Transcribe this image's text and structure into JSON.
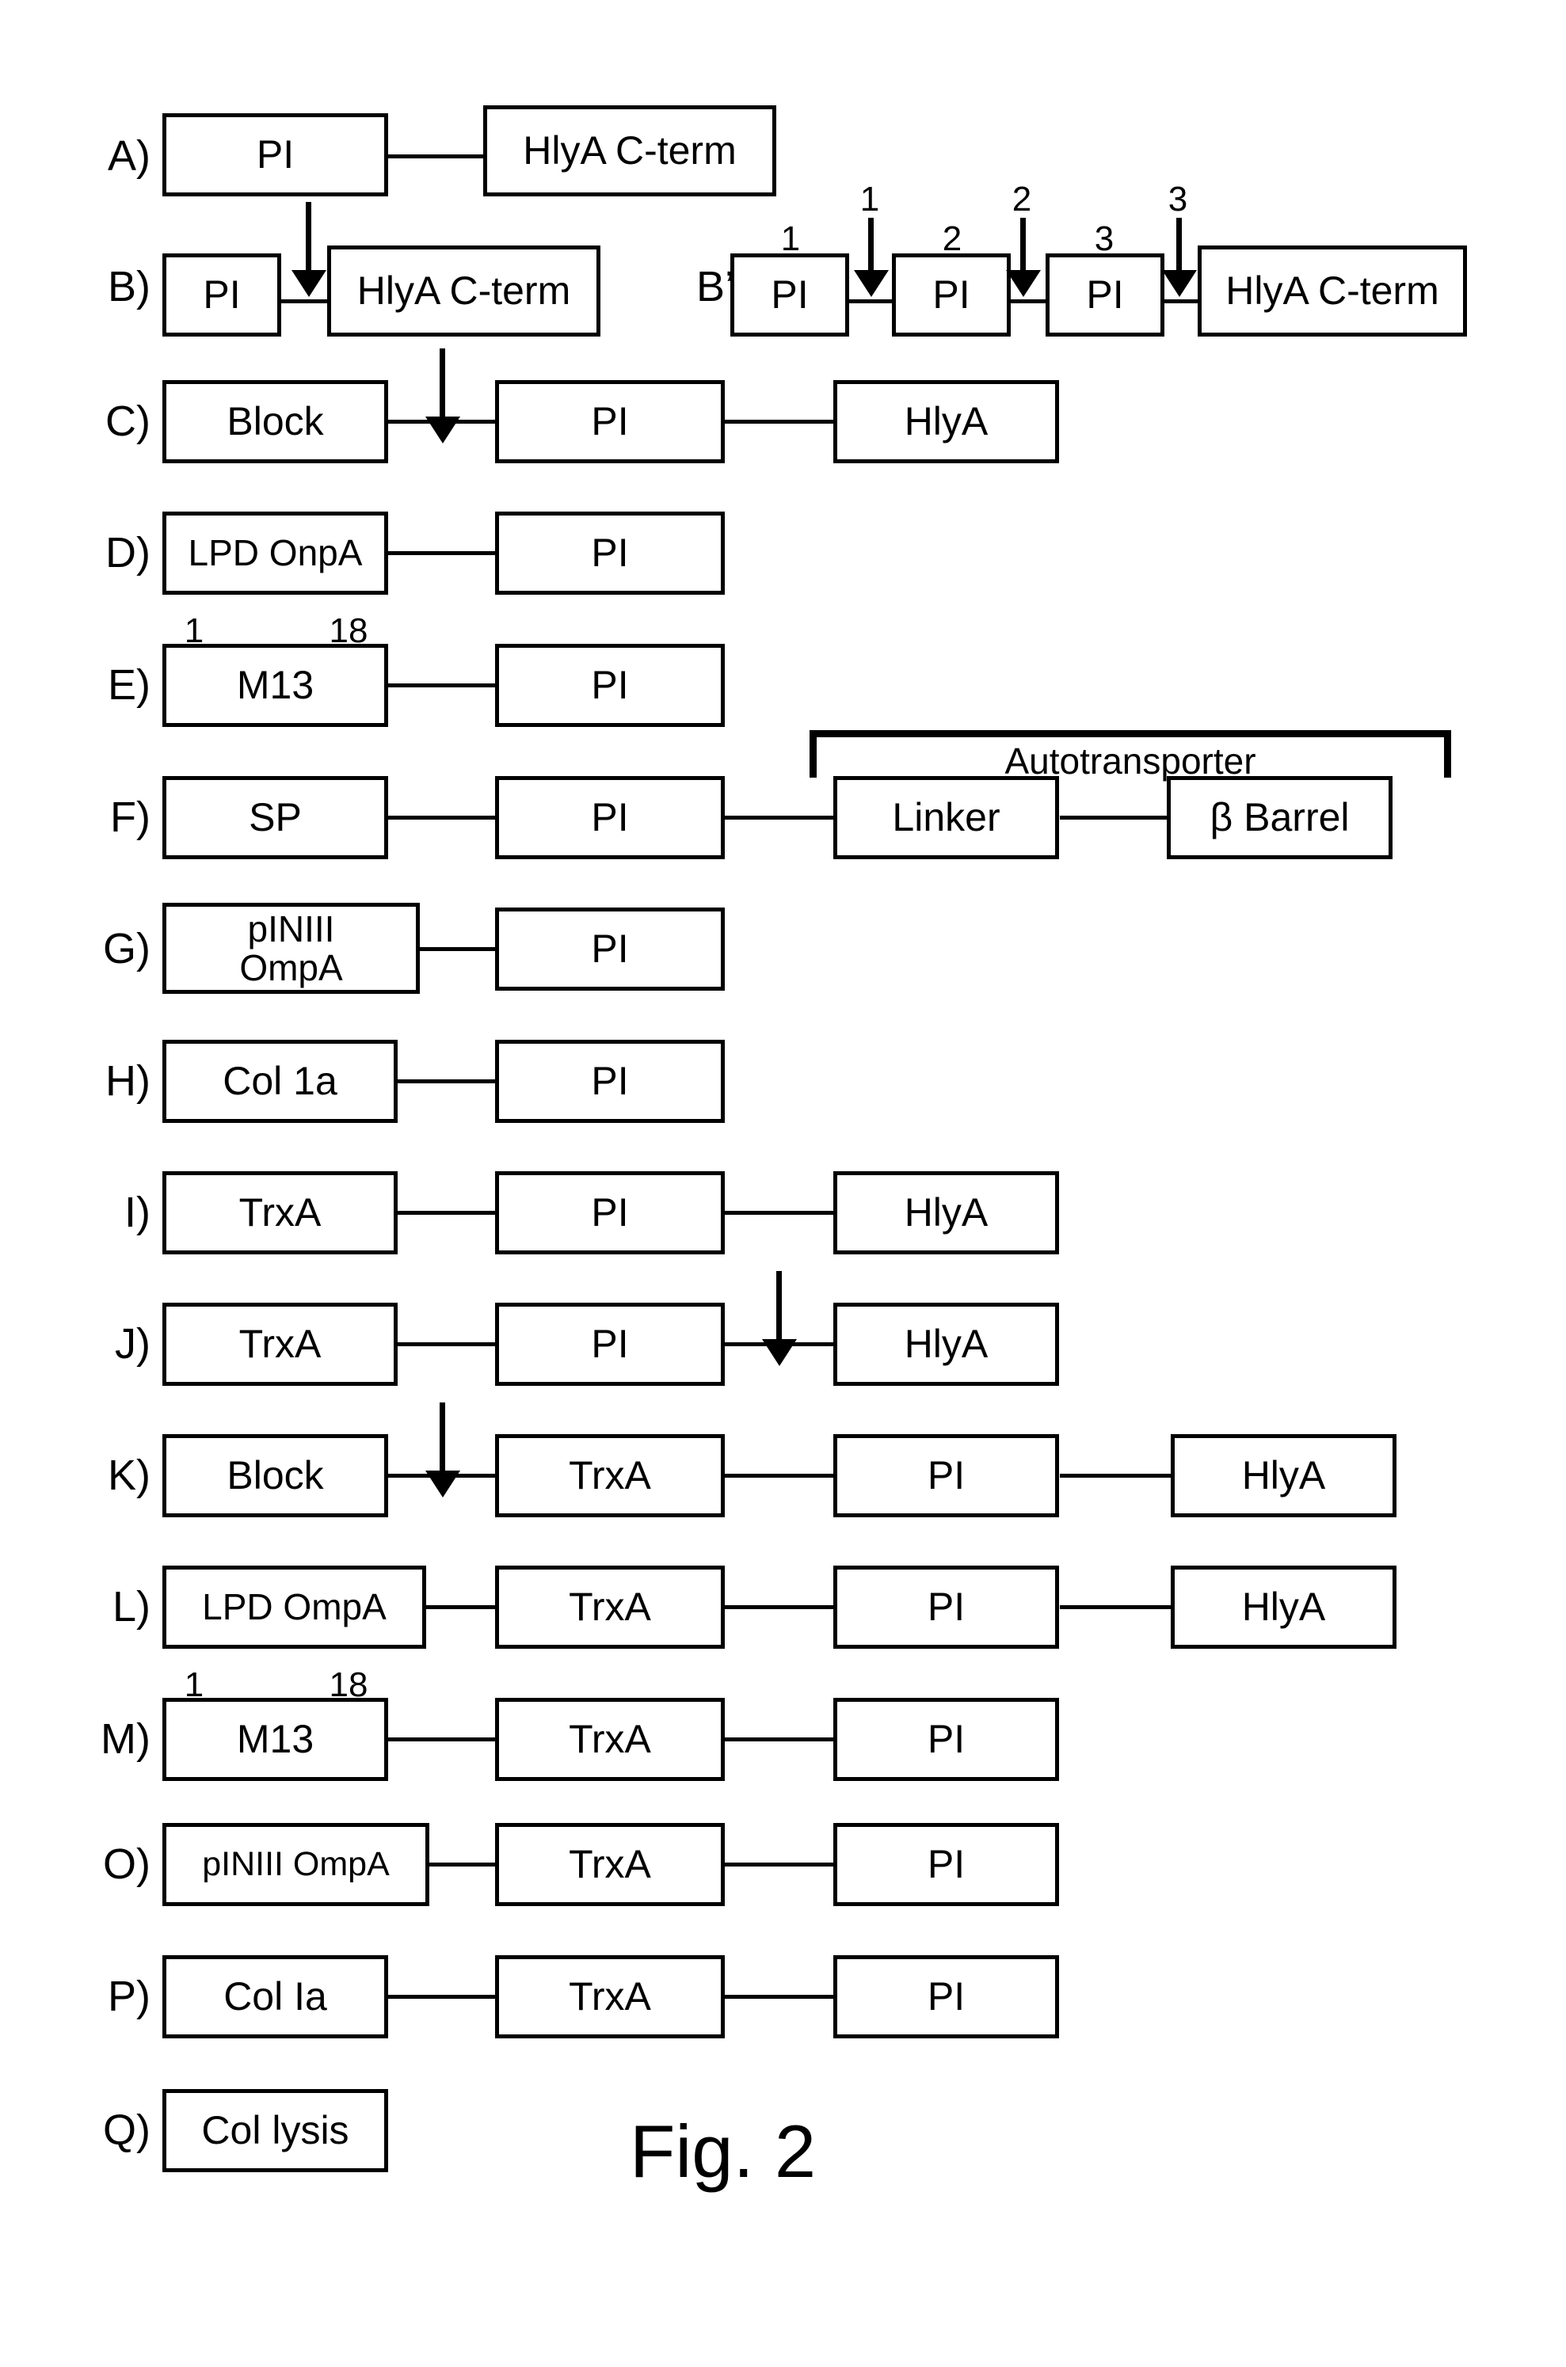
{
  "figure": {
    "caption": "Fig. 2",
    "rows": [
      {
        "id": "A",
        "letter": "A)",
        "boxes": [
          {
            "label": "PI"
          },
          {
            "label": "HlyA C-term"
          }
        ],
        "arrows": [],
        "annotations": []
      },
      {
        "id": "B",
        "letter": "B)",
        "boxes": [
          {
            "label": "PI"
          },
          {
            "label": "HlyA C-term"
          }
        ],
        "arrows": [
          {
            "target": "connector-1"
          }
        ],
        "annotations": []
      },
      {
        "id": "Bprime",
        "letter": "B’)",
        "boxes": [
          {
            "label": "PI",
            "top_number": "1"
          },
          {
            "label": "PI",
            "top_number": "2"
          },
          {
            "label": "PI",
            "top_number": "3"
          },
          {
            "label": "HlyA C-term"
          }
        ],
        "arrows": [
          {
            "target": "connector-1",
            "number": "1"
          },
          {
            "target": "connector-2",
            "number": "2"
          },
          {
            "target": "connector-3",
            "number": "3"
          }
        ],
        "annotations": []
      },
      {
        "id": "C",
        "letter": "C)",
        "boxes": [
          {
            "label": "Block"
          },
          {
            "label": "PI"
          },
          {
            "label": "HlyA"
          }
        ],
        "arrows": [
          {
            "target": "connector-1"
          }
        ],
        "annotations": []
      },
      {
        "id": "D",
        "letter": "D)",
        "boxes": [
          {
            "label": "LPD OnpA"
          },
          {
            "label": "PI"
          }
        ],
        "arrows": [],
        "annotations": []
      },
      {
        "id": "E",
        "letter": "E)",
        "boxes": [
          {
            "label": "M13",
            "top_left_number": "1",
            "top_right_number": "18"
          },
          {
            "label": "PI"
          }
        ],
        "arrows": [],
        "annotations": []
      },
      {
        "id": "F",
        "letter": "F)",
        "boxes": [
          {
            "label": "SP"
          },
          {
            "label": "PI"
          },
          {
            "label": "Linker"
          },
          {
            "label": "β Barrel"
          }
        ],
        "arrows": [],
        "annotations": [
          {
            "type": "bracket",
            "label": "Autotransporter",
            "spans": [
              "Linker",
              "β Barrel"
            ]
          }
        ]
      },
      {
        "id": "G",
        "letter": "G)",
        "boxes": [
          {
            "label": "pINIII\nOmpA"
          },
          {
            "label": "PI"
          }
        ],
        "arrows": [],
        "annotations": []
      },
      {
        "id": "H",
        "letter": "H)",
        "boxes": [
          {
            "label": "Col 1a"
          },
          {
            "label": "PI"
          }
        ],
        "arrows": [],
        "annotations": []
      },
      {
        "id": "I",
        "letter": "I)",
        "boxes": [
          {
            "label": "TrxA"
          },
          {
            "label": "PI"
          },
          {
            "label": "HlyA"
          }
        ],
        "arrows": [],
        "annotations": []
      },
      {
        "id": "J",
        "letter": "J)",
        "boxes": [
          {
            "label": "TrxA"
          },
          {
            "label": "PI"
          },
          {
            "label": "HlyA"
          }
        ],
        "arrows": [
          {
            "target": "connector-2"
          }
        ],
        "annotations": []
      },
      {
        "id": "K",
        "letter": "K)",
        "boxes": [
          {
            "label": "Block"
          },
          {
            "label": "TrxA"
          },
          {
            "label": "PI"
          },
          {
            "label": "HlyA"
          }
        ],
        "arrows": [
          {
            "target": "connector-1"
          }
        ],
        "annotations": []
      },
      {
        "id": "L",
        "letter": "L)",
        "boxes": [
          {
            "label": "LPD OmpA"
          },
          {
            "label": "TrxA"
          },
          {
            "label": "PI"
          },
          {
            "label": "HlyA"
          }
        ],
        "arrows": [],
        "annotations": []
      },
      {
        "id": "M",
        "letter": "M)",
        "boxes": [
          {
            "label": "M13",
            "top_left_number": "1",
            "top_right_number": "18"
          },
          {
            "label": "TrxA"
          },
          {
            "label": "PI"
          }
        ],
        "arrows": [],
        "annotations": []
      },
      {
        "id": "O",
        "letter": "O)",
        "boxes": [
          {
            "label": "pINIII OmpA"
          },
          {
            "label": "TrxA"
          },
          {
            "label": "PI"
          }
        ],
        "arrows": [],
        "annotations": []
      },
      {
        "id": "P",
        "letter": "P)",
        "boxes": [
          {
            "label": "Col Ia"
          },
          {
            "label": "TrxA"
          },
          {
            "label": "PI"
          }
        ],
        "arrows": [],
        "annotations": []
      },
      {
        "id": "Q",
        "letter": "Q)",
        "boxes": [
          {
            "label": "Col lysis"
          }
        ],
        "arrows": [],
        "annotations": []
      }
    ]
  },
  "colors": {
    "ink": "#000000",
    "paper": "#ffffff"
  }
}
